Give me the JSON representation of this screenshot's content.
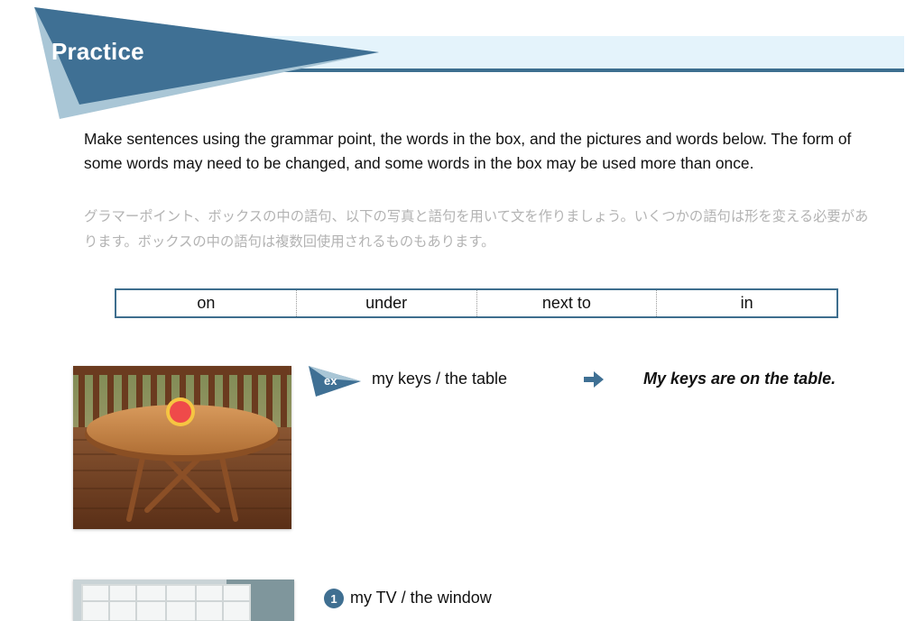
{
  "header": {
    "title": "Practice"
  },
  "instructions": {
    "english": "Make sentences using the grammar point, the words in the box, and the pictures and words below. The form of some words may need to be changed, and some words in the box may be used more than once.",
    "japanese": "グラマーポイント、ボックスの中の語句、以下の写真と語句を用いて文を作りましょう。いくつかの語句は形を変える必要があります。ボックスの中の語句は複数回使用されるものもあります。"
  },
  "word_box": [
    "on",
    "under",
    "next to",
    "in"
  ],
  "example": {
    "badge": "ex",
    "prompt": "my keys / the table",
    "arrow_icon": "right-arrow-icon",
    "answer": "My keys are on the table."
  },
  "items": [
    {
      "number": "1",
      "prompt": "my TV / the window"
    }
  ],
  "colors": {
    "accent": "#3f6f91",
    "banner_light": "#e4f3fb",
    "marker": "#ef4a4a"
  }
}
